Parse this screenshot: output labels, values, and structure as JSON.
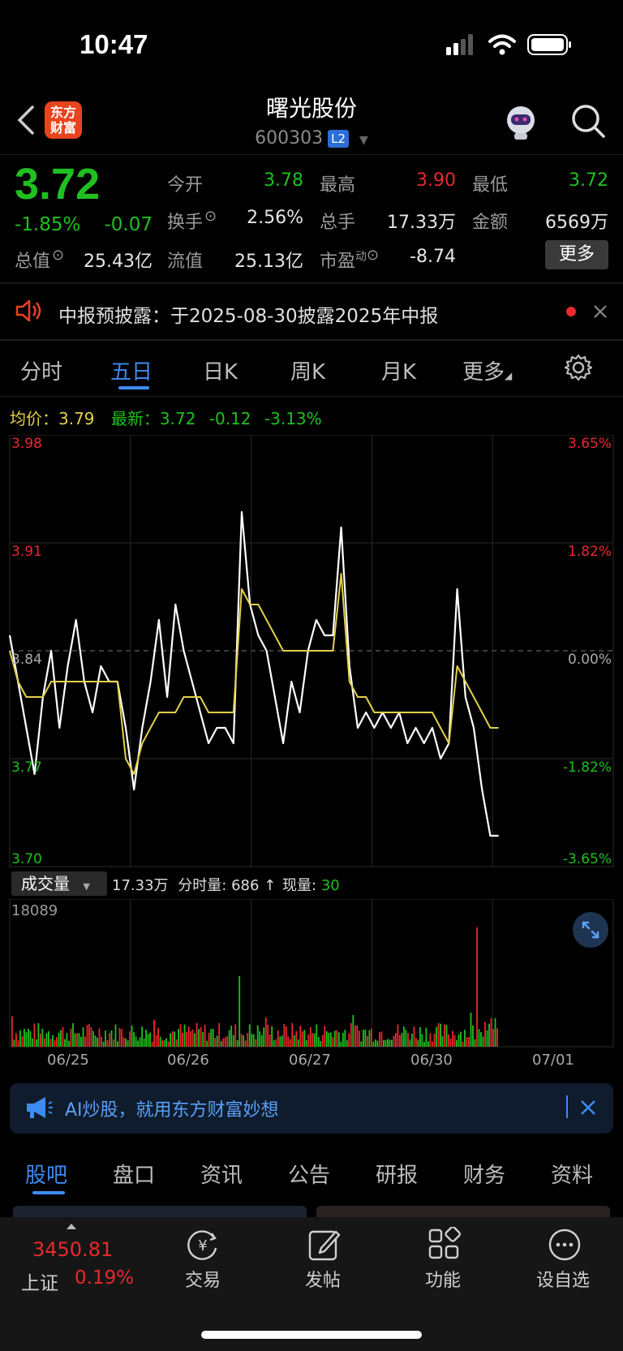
{
  "status": {
    "time": "10:47"
  },
  "header": {
    "title": "曙光股份",
    "code": "600303",
    "level": "L2",
    "logo_line1": "东方",
    "logo_line2": "财富"
  },
  "quote": {
    "price": "3.72",
    "change_pct": "-1.85%",
    "change": "-0.07",
    "open_label": "今开",
    "open": "3.78",
    "high_label": "最高",
    "high": "3.90",
    "low_label": "最低",
    "low": "3.72",
    "turnover_label": "换手",
    "turnover": "2.56%",
    "volume_label": "总手",
    "volume": "17.33万",
    "amount_label": "金额",
    "amount": "6569万",
    "mcap_label": "总值",
    "mcap": "25.43亿",
    "float_label": "流值",
    "float": "25.13亿",
    "pe_label": "市盈",
    "pe_sup": "动",
    "pe": "-8.74",
    "more_label": "更多"
  },
  "notice": {
    "text": "中报预披露：于2025-08-30披露2025年中报"
  },
  "period_tabs": [
    "分时",
    "五日",
    "日K",
    "周K",
    "月K",
    "更多"
  ],
  "chart_header": {
    "avg_label": "均价：",
    "avg": "3.79",
    "last_label": "最新：",
    "last": "3.72",
    "last_change": "-0.12",
    "last_pct": "-3.13%"
  },
  "chart_data": {
    "type": "line",
    "y_ticks_left": [
      "3.98",
      "3.91",
      "3.84",
      "3.77",
      "3.70"
    ],
    "y_ticks_right": [
      "3.65%",
      "1.82%",
      "0.00%",
      "-1.82%",
      "-3.65%"
    ],
    "ylim": [
      3.7,
      3.98
    ],
    "baseline": 3.84,
    "x_labels": [
      "06/25",
      "06/26",
      "06/27",
      "06/30",
      "07/01"
    ],
    "series": [
      {
        "values": [
          3.85,
          3.82,
          3.79,
          3.76,
          3.81,
          3.84,
          3.79,
          3.83,
          3.86,
          3.82,
          3.8,
          3.83,
          3.82,
          3.82,
          3.79,
          3.75,
          3.79,
          3.82,
          3.86,
          3.81,
          3.87,
          3.84,
          3.82,
          3.8,
          3.78,
          3.79,
          3.79,
          3.78,
          3.93,
          3.87,
          3.85,
          3.84,
          3.81,
          3.78,
          3.82,
          3.8,
          3.84,
          3.86,
          3.85,
          3.85,
          3.92,
          3.83,
          3.79,
          3.8,
          3.79,
          3.8,
          3.79,
          3.8,
          3.78,
          3.79,
          3.78,
          3.79,
          3.77,
          3.78,
          3.88,
          3.81,
          3.79,
          3.75,
          3.72,
          3.72
        ]
      },
      {
        "values": [
          3.84,
          3.82,
          3.81,
          3.81,
          3.81,
          3.82,
          3.82,
          3.82,
          3.82,
          3.82,
          3.82,
          3.82,
          3.82,
          3.82,
          3.77,
          3.76,
          3.78,
          3.79,
          3.8,
          3.8,
          3.8,
          3.81,
          3.81,
          3.81,
          3.8,
          3.8,
          3.8,
          3.8,
          3.88,
          3.87,
          3.87,
          3.86,
          3.85,
          3.84,
          3.84,
          3.84,
          3.84,
          3.84,
          3.84,
          3.84,
          3.89,
          3.82,
          3.81,
          3.81,
          3.8,
          3.8,
          3.8,
          3.8,
          3.8,
          3.8,
          3.8,
          3.8,
          3.79,
          3.78,
          3.83,
          3.82,
          3.81,
          3.8,
          3.79,
          3.79
        ]
      }
    ],
    "volume": {
      "max_label": "18089"
    }
  },
  "volume_bar": {
    "label": "成交量",
    "total": "17.33万",
    "minute_label": "分时量:",
    "minute": "686",
    "now_label": "现量:",
    "now": "30"
  },
  "ai_banner": {
    "text": "AI炒股，就用东方财富妙想"
  },
  "bottom_tabs": [
    "股吧",
    "盘口",
    "资讯",
    "公告",
    "研报",
    "财务",
    "资料"
  ],
  "dock": {
    "index_value": "3450.81",
    "index_name": "上证",
    "index_pct": "0.19%",
    "trade": "交易",
    "post": "发帖",
    "func": "功能",
    "watch": "设自选"
  },
  "colors": {
    "up": "#e8292d",
    "down": "#1fc01f",
    "accent": "#3d8bf2",
    "avg_line": "#e2d04a"
  }
}
